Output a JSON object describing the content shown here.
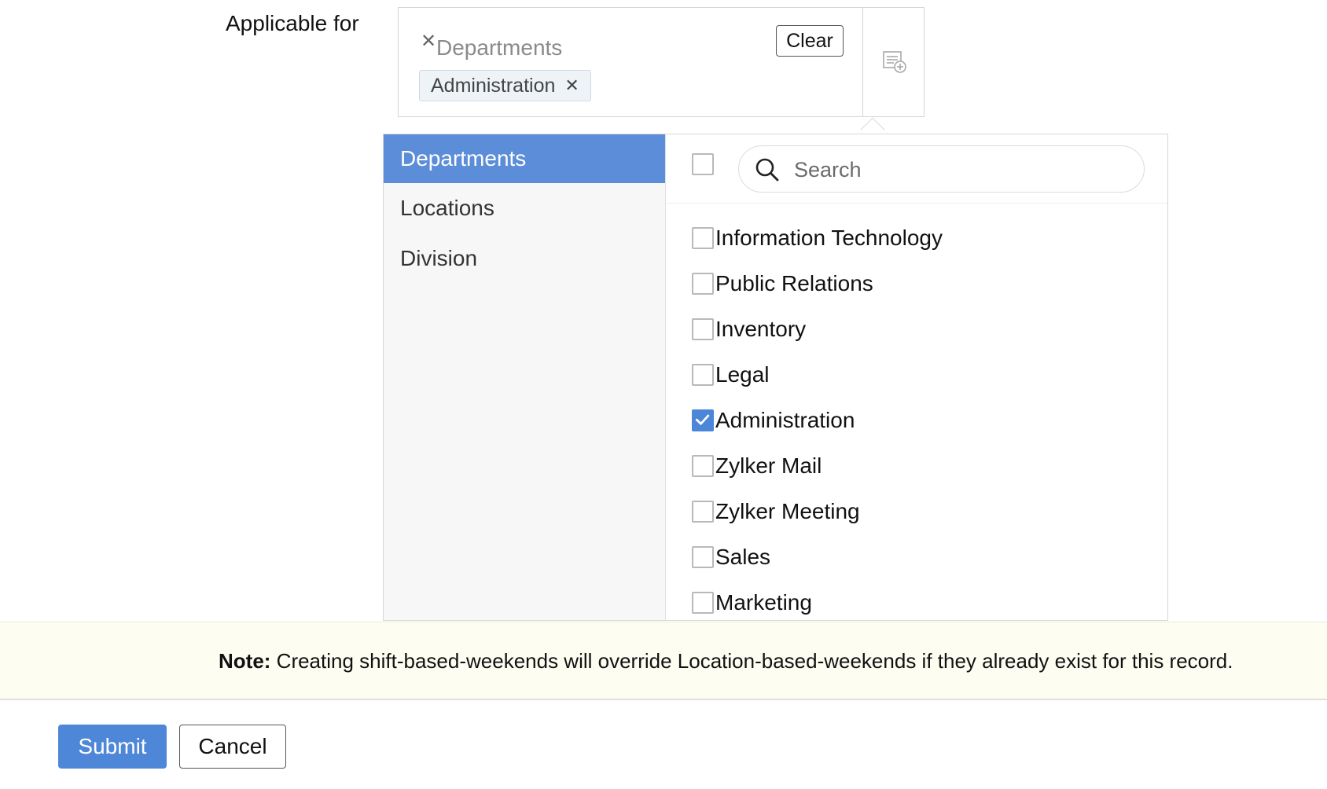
{
  "form": {
    "label": "Applicable for",
    "group_name": "Departments",
    "clear_label": "Clear",
    "selected_chip": "Administration"
  },
  "dropdown": {
    "categories": [
      {
        "label": "Departments",
        "active": true
      },
      {
        "label": "Locations",
        "active": false
      },
      {
        "label": "Division",
        "active": false
      }
    ],
    "search_placeholder": "Search",
    "options": [
      {
        "label": "Information Technology",
        "checked": false
      },
      {
        "label": "Public Relations",
        "checked": false
      },
      {
        "label": "Inventory",
        "checked": false
      },
      {
        "label": "Legal",
        "checked": false
      },
      {
        "label": "Administration",
        "checked": true
      },
      {
        "label": "Zylker Mail",
        "checked": false
      },
      {
        "label": "Zylker Meeting",
        "checked": false
      },
      {
        "label": "Sales",
        "checked": false
      },
      {
        "label": "Marketing",
        "checked": false
      }
    ]
  },
  "note": {
    "prefix": "Note:",
    "text": " Creating shift-based-weekends will override Location-based-weekends if they already exist for this record."
  },
  "actions": {
    "submit_label": "Submit",
    "cancel_label": "Cancel"
  },
  "colors": {
    "accent": "#4f87d8",
    "active_category": "#5b8dd9",
    "note_background": "#fdfdf1"
  }
}
